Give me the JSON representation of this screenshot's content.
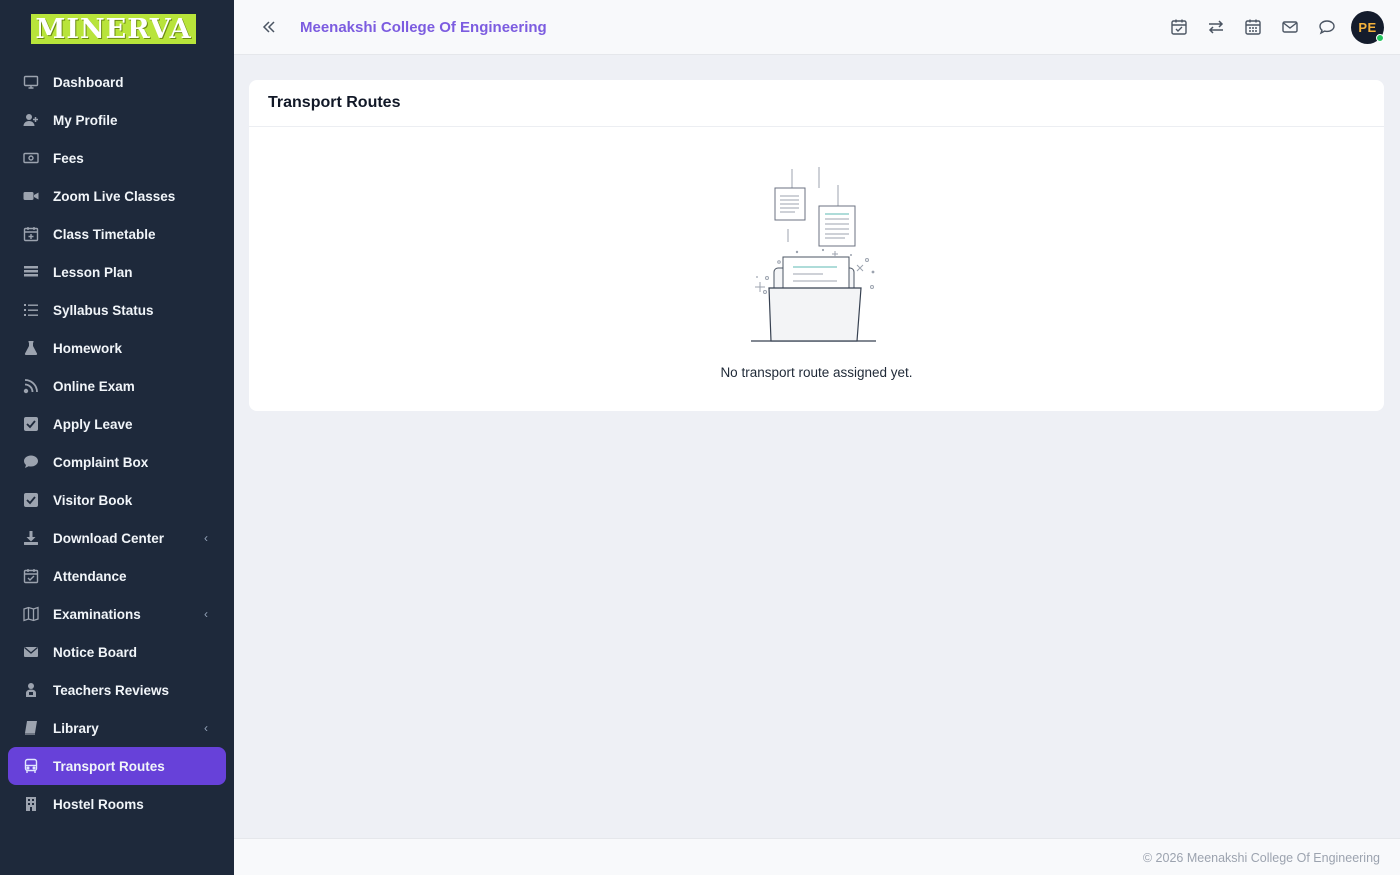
{
  "brand": {
    "logo_text": "MINERVA",
    "logo_bg": "#b8e43a"
  },
  "header": {
    "college_name": "Meenakshi College Of Engineering",
    "avatar_initials": "PE"
  },
  "sidebar": {
    "items": [
      {
        "label": "Dashboard",
        "icon": "monitor-icon"
      },
      {
        "label": "My Profile",
        "icon": "user-plus-icon"
      },
      {
        "label": "Fees",
        "icon": "money-icon"
      },
      {
        "label": "Zoom Live Classes",
        "icon": "video-icon"
      },
      {
        "label": "Class Timetable",
        "icon": "calendar-plus-icon"
      },
      {
        "label": "Lesson Plan",
        "icon": "list-lines-icon"
      },
      {
        "label": "Syllabus Status",
        "icon": "list-ol-icon"
      },
      {
        "label": "Homework",
        "icon": "flask-icon"
      },
      {
        "label": "Online Exam",
        "icon": "rss-icon"
      },
      {
        "label": "Apply Leave",
        "icon": "check-square-icon"
      },
      {
        "label": "Complaint Box",
        "icon": "comment-icon"
      },
      {
        "label": "Visitor Book",
        "icon": "check-square-icon"
      },
      {
        "label": "Download Center",
        "icon": "download-icon"
      },
      {
        "label": "Attendance",
        "icon": "calendar-check-icon"
      },
      {
        "label": "Examinations",
        "icon": "map-icon"
      },
      {
        "label": "Notice Board",
        "icon": "envelope-icon"
      },
      {
        "label": "Teachers Reviews",
        "icon": "reviews-icon"
      },
      {
        "label": "Library",
        "icon": "book-icon"
      },
      {
        "label": "Transport Routes",
        "icon": "bus-icon"
      },
      {
        "label": "Hostel Rooms",
        "icon": "building-icon"
      }
    ],
    "active": "Transport Routes",
    "accent": "#6741d9"
  },
  "card": {
    "title": "Transport Routes",
    "empty_message": "No transport route assigned yet."
  },
  "footer": {
    "text": "© 2026 Meenakshi College Of Engineering"
  }
}
